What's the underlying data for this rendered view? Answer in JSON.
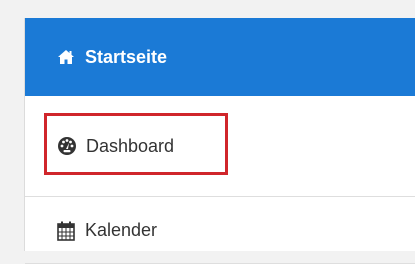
{
  "nav": {
    "items": [
      {
        "label": "Startseite",
        "icon": "home-icon",
        "active": true
      },
      {
        "label": "Dashboard",
        "icon": "dashboard-gauge-icon",
        "active": false,
        "highlighted": true
      },
      {
        "label": "Kalender",
        "icon": "calendar-icon",
        "active": false
      }
    ]
  },
  "colors": {
    "active_bg": "#1b7ad6",
    "highlight_border": "#d0262b",
    "text": "#333333"
  }
}
